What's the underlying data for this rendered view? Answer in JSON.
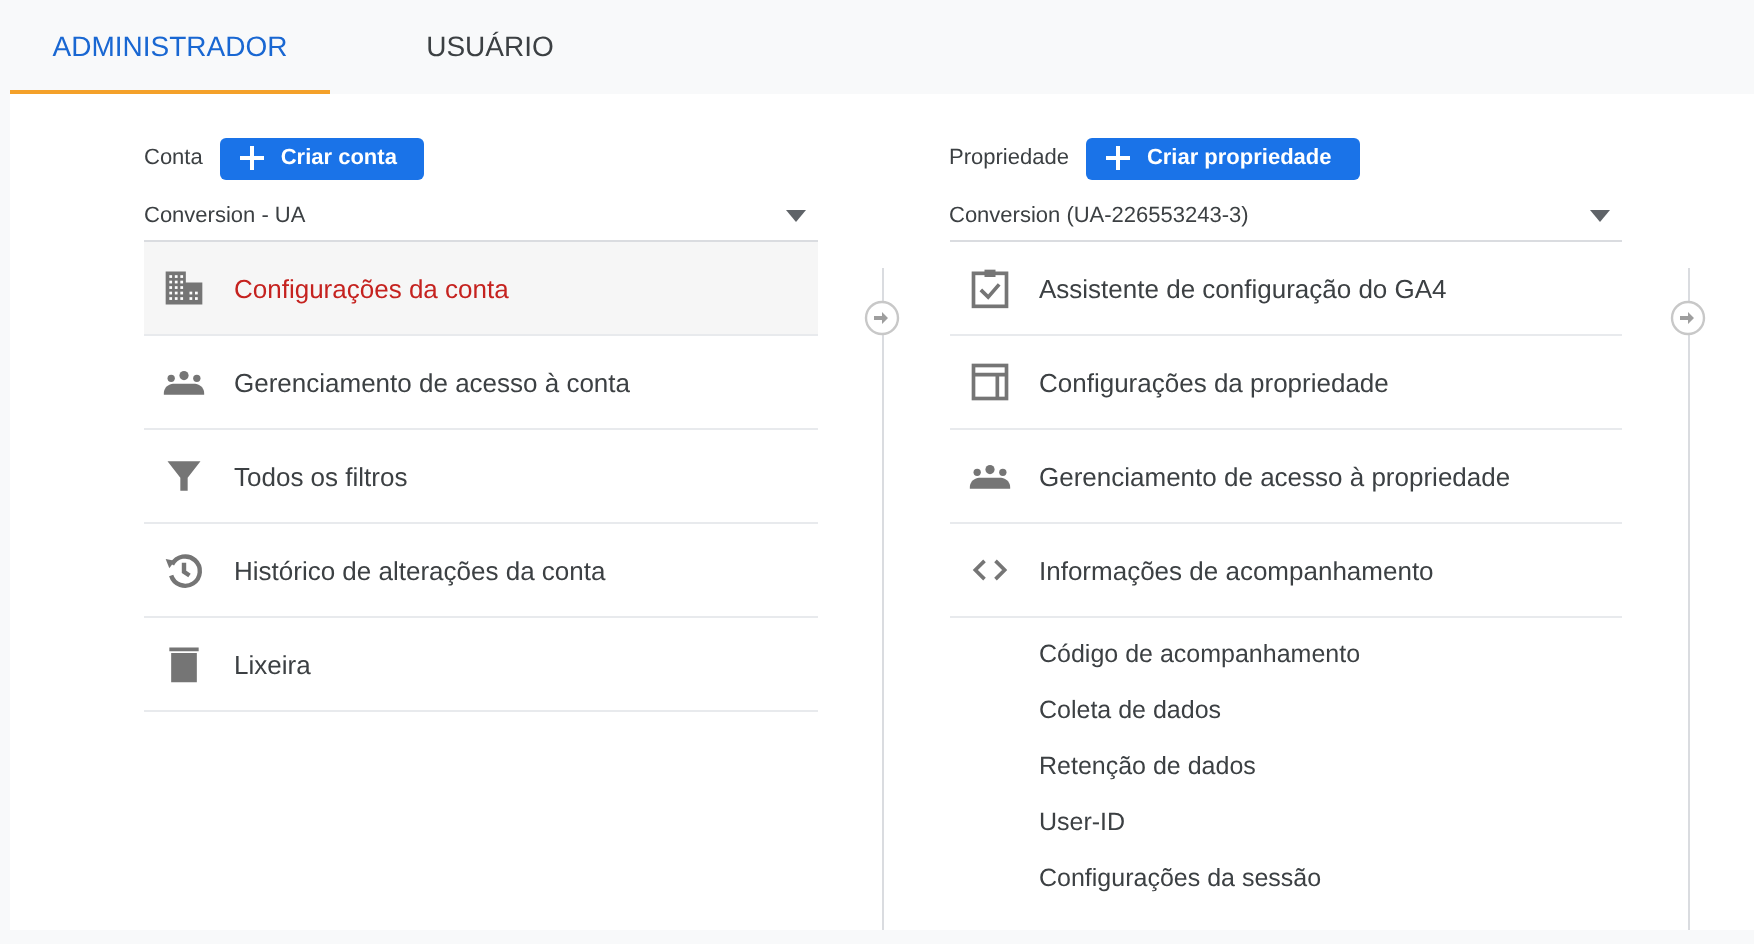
{
  "tabs": [
    {
      "label": "ADMINISTRADOR",
      "selected": true
    },
    {
      "label": "USUÁRIO",
      "selected": false
    }
  ],
  "columns": [
    {
      "label": "Conta",
      "create_button": "Criar conta",
      "selector": "Conversion - UA",
      "items": [
        {
          "kind": "building",
          "label": "Configurações da conta",
          "selected": true
        },
        {
          "kind": "people",
          "label": "Gerenciamento de acesso à conta",
          "selected": false
        },
        {
          "kind": "filter",
          "label": "Todos os filtros",
          "selected": false
        },
        {
          "kind": "history",
          "label": "Histórico de alterações da conta",
          "selected": false
        },
        {
          "kind": "trash",
          "label": "Lixeira",
          "selected": false
        }
      ]
    },
    {
      "label": "Propriedade",
      "create_button": "Criar propriedade",
      "selector": "Conversion (UA-226553243-3)",
      "items": [
        {
          "kind": "checklist",
          "label": "Assistente de configuração do GA4",
          "selected": false
        },
        {
          "kind": "layout",
          "label": "Configurações da propriedade",
          "selected": false
        },
        {
          "kind": "people",
          "label": "Gerenciamento de acesso à propriedade",
          "selected": false
        },
        {
          "kind": "code",
          "label": "Informações de acompanhamento",
          "selected": false,
          "children": [
            {
              "label": "Código de acompanhamento"
            },
            {
              "label": "Coleta de dados"
            },
            {
              "label": "Retenção de dados"
            },
            {
              "label": "User-ID"
            },
            {
              "label": "Configurações da sessão"
            }
          ]
        }
      ]
    }
  ]
}
